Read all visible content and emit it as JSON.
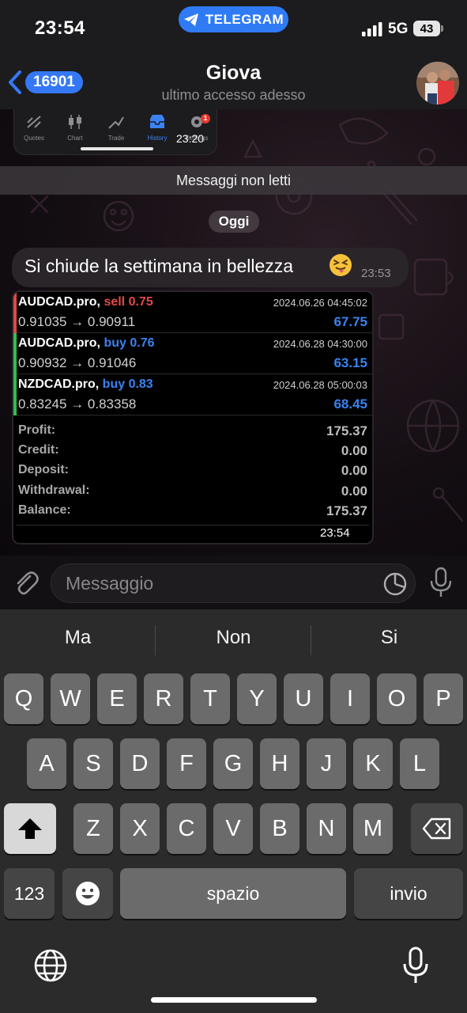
{
  "status_bar": {
    "time": "23:54",
    "app_pill": "TELEGRAM",
    "network": "5G",
    "battery": "43"
  },
  "header": {
    "back_count": "16901",
    "name": "Giova",
    "status": "ultimo accesso adesso"
  },
  "preview_image": {
    "tabs": [
      "Quotes",
      "Chart",
      "Trade",
      "History",
      "Settings"
    ],
    "badge": "1",
    "time": "23:20"
  },
  "chat": {
    "unread_label": "Messaggi non letti",
    "date_chip": "Oggi",
    "message": {
      "text": "Si chiude la settimana in bellezza",
      "emoji": "squinting-face-with-tongue",
      "time": "23:53"
    },
    "trades": [
      {
        "symbol": "AUDCAD.pro,",
        "side": "sell 0.75",
        "side_type": "sell",
        "date": "2024.06.26 04:45:02",
        "prices": "0.91035 → 0.90911",
        "profit": "67.75",
        "bar_color": "#e24848"
      },
      {
        "symbol": "AUDCAD.pro,",
        "side": "buy 0.76",
        "side_type": "buy",
        "date": "2024.06.28 04:30:00",
        "prices": "0.90932 → 0.91046",
        "profit": "63.15",
        "bar_color": "#2fbf4f"
      },
      {
        "symbol": "NZDCAD.pro,",
        "side": "buy 0.83",
        "side_type": "buy",
        "date": "2024.06.28 05:00:03",
        "prices": "0.83245 → 0.83358",
        "profit": "68.45",
        "bar_color": "#2fbf4f"
      }
    ],
    "summary": [
      {
        "label": "Profit:",
        "value": "175.37"
      },
      {
        "label": "Credit:",
        "value": "0.00"
      },
      {
        "label": "Deposit:",
        "value": "0.00"
      },
      {
        "label": "Withdrawal:",
        "value": "0.00"
      },
      {
        "label": "Balance:",
        "value": "175.37"
      }
    ],
    "image_time": "23:54"
  },
  "input": {
    "placeholder": "Messaggio",
    "value": ""
  },
  "keyboard": {
    "suggestions": [
      "Ma",
      "Non",
      "Si"
    ],
    "row1": [
      "Q",
      "W",
      "E",
      "R",
      "T",
      "Y",
      "U",
      "I",
      "O",
      "P"
    ],
    "row2": [
      "A",
      "S",
      "D",
      "F",
      "G",
      "H",
      "J",
      "K",
      "L"
    ],
    "row3": [
      "Z",
      "X",
      "C",
      "V",
      "B",
      "N",
      "M"
    ],
    "numbers_key": "123",
    "space_key": "spazio",
    "return_key": "invio"
  },
  "colors": {
    "accent": "#3478f6",
    "sell": "#e24848",
    "buy": "#3a82f0"
  }
}
